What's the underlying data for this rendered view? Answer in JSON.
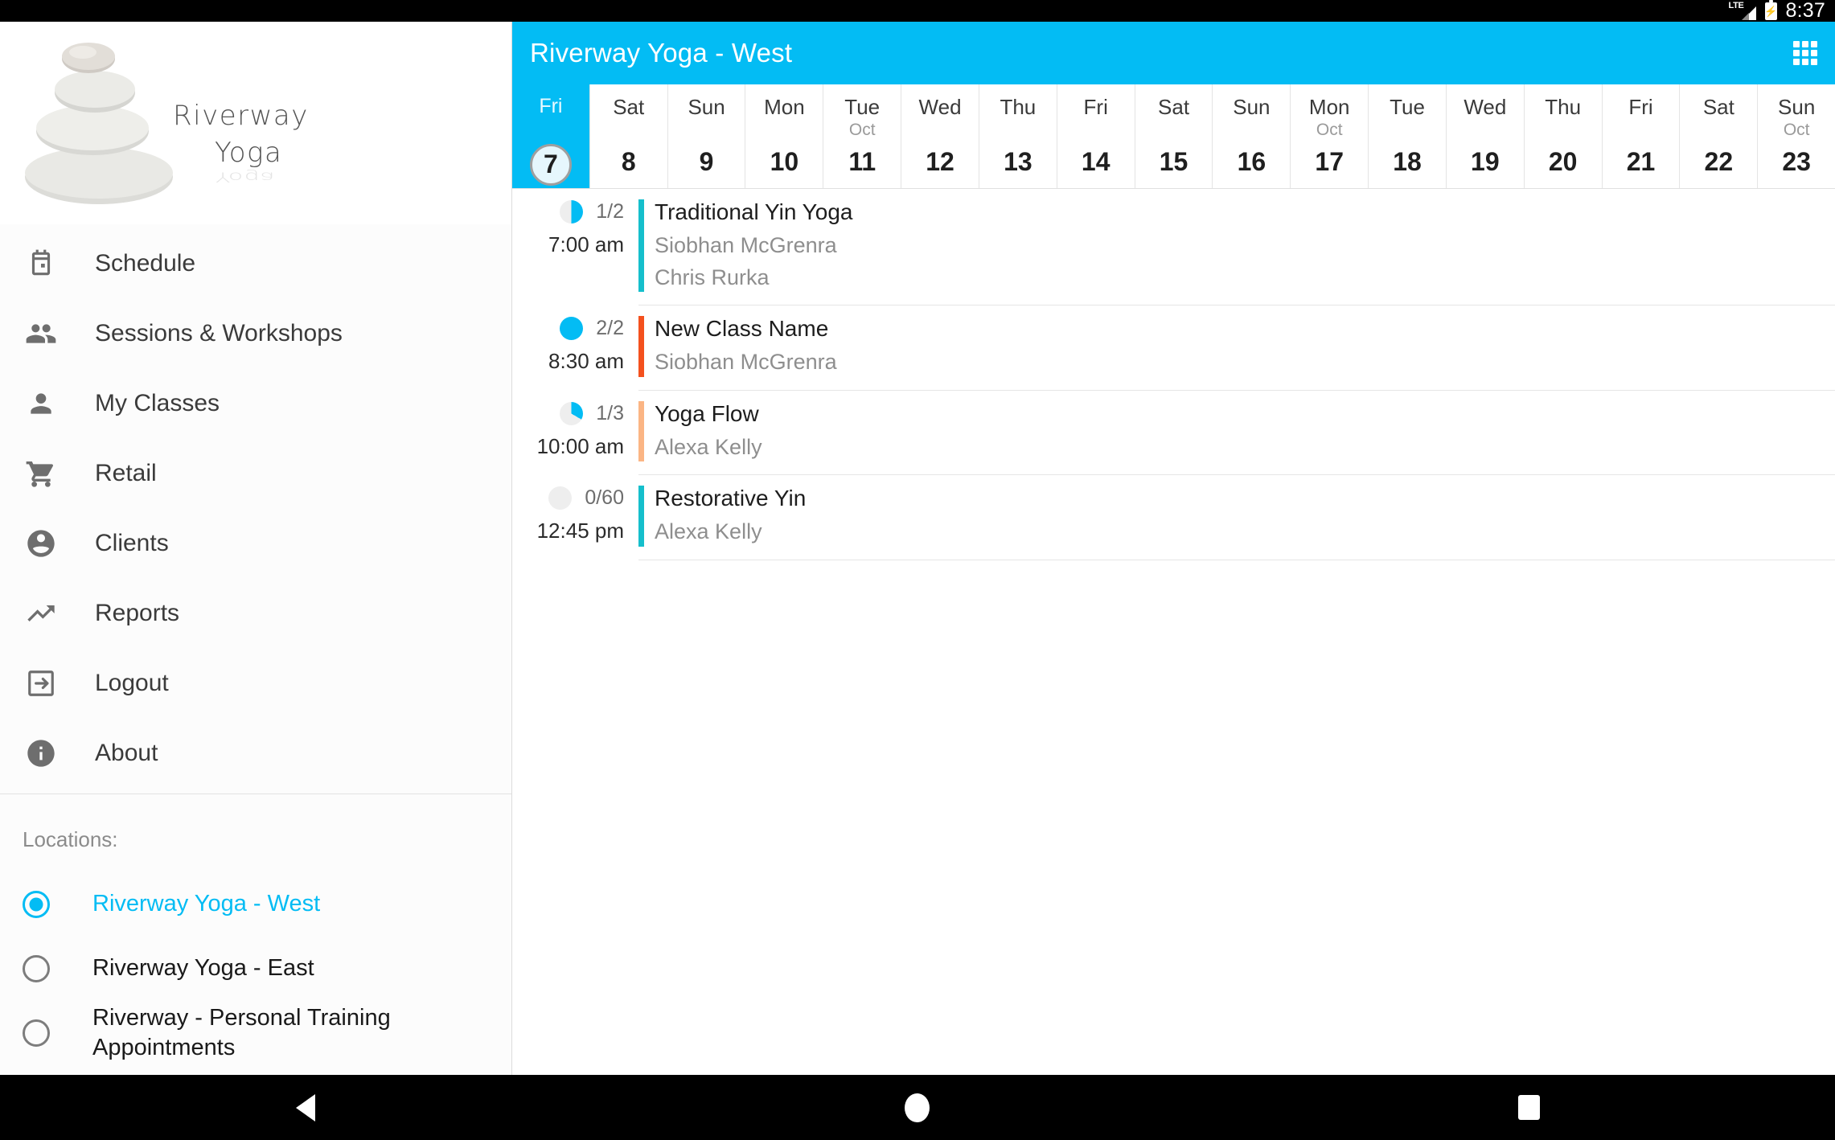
{
  "statusbar": {
    "network_label": "LTE",
    "signal_icon": "signal-bars-icon",
    "battery_icon": "battery-charging-icon",
    "time": "8:37"
  },
  "brand": {
    "accent": "#03bcf4",
    "logo_line1": "Riverway",
    "logo_line2": "Yoga",
    "logo_reflection": "Yoga"
  },
  "sidebar": {
    "items": [
      {
        "label": "Schedule",
        "icon": "calendar-icon"
      },
      {
        "label": "Sessions & Workshops",
        "icon": "people-icon"
      },
      {
        "label": "My Classes",
        "icon": "person-icon"
      },
      {
        "label": "Retail",
        "icon": "shopping-cart-icon"
      },
      {
        "label": "Clients",
        "icon": "account-circle-icon"
      },
      {
        "label": "Reports",
        "icon": "trending-up-icon"
      },
      {
        "label": "Logout",
        "icon": "exit-to-app-icon"
      },
      {
        "label": "About",
        "icon": "info-icon"
      }
    ],
    "locations_title": "Locations:",
    "locations": [
      {
        "label": "Riverway Yoga - West",
        "selected": true
      },
      {
        "label": "Riverway Yoga - East",
        "selected": false
      },
      {
        "label": "Riverway - Personal Training Appointments",
        "selected": false
      }
    ]
  },
  "appbar": {
    "title": "Riverway Yoga - West",
    "grid_icon": "apps-grid-icon"
  },
  "daystrip": {
    "days": [
      {
        "dow": "Fri",
        "month": "",
        "num": "7",
        "selected": true
      },
      {
        "dow": "Sat",
        "month": "",
        "num": "8",
        "selected": false
      },
      {
        "dow": "Sun",
        "month": "",
        "num": "9",
        "selected": false
      },
      {
        "dow": "Mon",
        "month": "",
        "num": "10",
        "selected": false
      },
      {
        "dow": "Tue",
        "month": "Oct",
        "num": "11",
        "selected": false
      },
      {
        "dow": "Wed",
        "month": "",
        "num": "12",
        "selected": false
      },
      {
        "dow": "Thu",
        "month": "",
        "num": "13",
        "selected": false
      },
      {
        "dow": "Fri",
        "month": "",
        "num": "14",
        "selected": false
      },
      {
        "dow": "Sat",
        "month": "",
        "num": "15",
        "selected": false
      },
      {
        "dow": "Sun",
        "month": "",
        "num": "16",
        "selected": false
      },
      {
        "dow": "Mon",
        "month": "Oct",
        "num": "17",
        "selected": false
      },
      {
        "dow": "Tue",
        "month": "",
        "num": "18",
        "selected": false
      },
      {
        "dow": "Wed",
        "month": "",
        "num": "19",
        "selected": false
      },
      {
        "dow": "Thu",
        "month": "",
        "num": "20",
        "selected": false
      },
      {
        "dow": "Fri",
        "month": "",
        "num": "21",
        "selected": false
      },
      {
        "dow": "Sat",
        "month": "",
        "num": "22",
        "selected": false
      },
      {
        "dow": "Sun",
        "month": "Oct",
        "num": "23",
        "selected": false
      }
    ]
  },
  "classes": [
    {
      "capacity": "1/2",
      "filled": 1,
      "total": 2,
      "time": "7:00 am",
      "name": "Traditional Yin Yoga",
      "staff": [
        "Siobhan McGrenra",
        "Chris Rurka"
      ],
      "bar_color": "#15bfcc"
    },
    {
      "capacity": "2/2",
      "filled": 2,
      "total": 2,
      "time": "8:30 am",
      "name": "New Class Name",
      "staff": [
        "Siobhan McGrenra"
      ],
      "bar_color": "#f4511e"
    },
    {
      "capacity": "1/3",
      "filled": 1,
      "total": 3,
      "time": "10:00 am",
      "name": "Yoga Flow",
      "staff": [
        "Alexa Kelly"
      ],
      "bar_color": "#fbb584"
    },
    {
      "capacity": "0/60",
      "filled": 0,
      "total": 60,
      "time": "12:45 pm",
      "name": "Restorative Yin",
      "staff": [
        "Alexa Kelly"
      ],
      "bar_color": "#15bfcc"
    }
  ],
  "navbar": {
    "back": "back-triangle-icon",
    "home": "home-circle-icon",
    "recents": "recents-square-icon"
  }
}
